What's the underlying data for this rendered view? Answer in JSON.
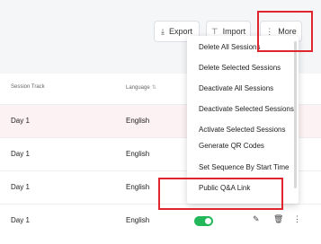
{
  "toolbar": {
    "export_label": "Export",
    "import_label": "Import",
    "more_label": "More"
  },
  "table": {
    "columns": {
      "track": "Session Track",
      "language": "Language"
    },
    "rows": [
      {
        "track": "Day 1",
        "language": "English"
      },
      {
        "track": "Day 1",
        "language": "English"
      },
      {
        "track": "Day 1",
        "language": "English"
      },
      {
        "track": "Day 1",
        "language": "English"
      }
    ]
  },
  "menu": {
    "items": [
      "Delete All Sessions",
      "Delete Selected Sessions",
      "Deactivate All Sessions",
      "Deactivate Selected Sessions",
      "Activate Selected Sessions",
      "Generate QR Codes",
      "Set Sequence By Start Time",
      "Public Q&A Link"
    ]
  },
  "icons": {
    "export": "download-icon",
    "import": "filter-icon",
    "more": "vertical-dots-icon",
    "sort": "sort-icon",
    "edit": "pencil-icon",
    "delete": "trash-icon",
    "row_more": "vertical-dots-icon"
  },
  "colors": {
    "highlight": "#e0262c",
    "toggle_on": "#22b85a",
    "row_highlight": "#fdf2f3"
  }
}
